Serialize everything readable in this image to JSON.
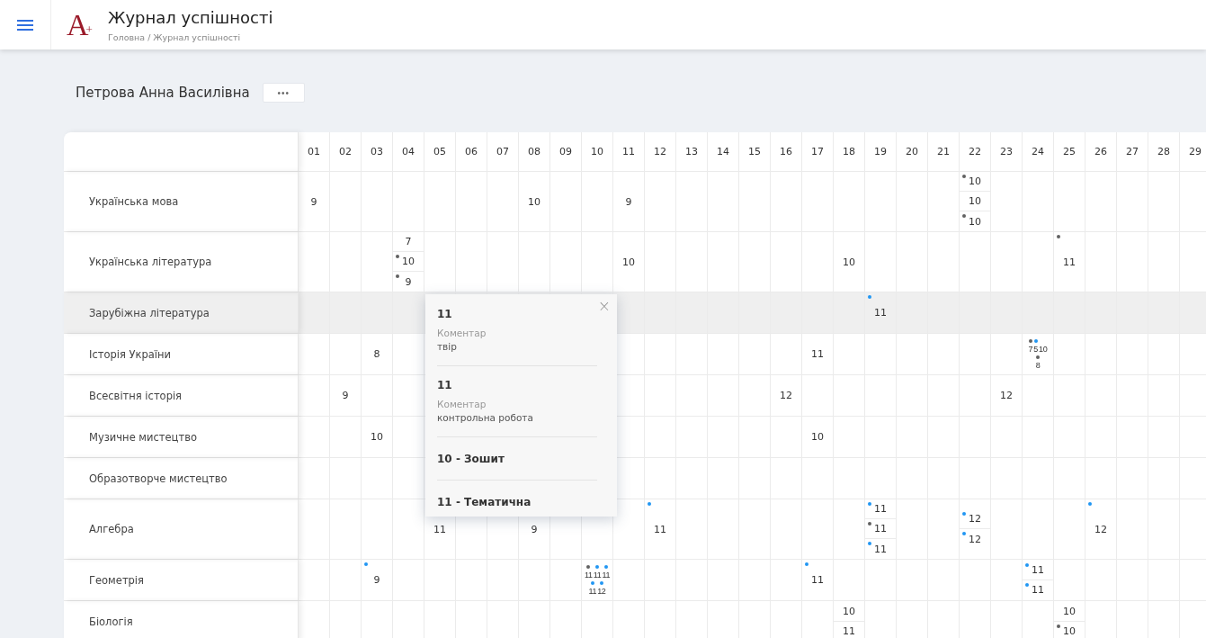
{
  "header": {
    "title": "Журнал успішності",
    "breadcrumb": "Головна / Журнал успішності",
    "logo": "A",
    "logo_sup": "+"
  },
  "student": {
    "name": "Петрова Анна Василівна",
    "more": "•••"
  },
  "days": [
    "01",
    "02",
    "03",
    "04",
    "05",
    "06",
    "07",
    "08",
    "09",
    "10",
    "11",
    "12",
    "13",
    "14",
    "15",
    "16",
    "17",
    "18",
    "19",
    "20",
    "21",
    "22",
    "23",
    "24",
    "25",
    "26",
    "27",
    "28",
    "29"
  ],
  "rows": [
    {
      "subject": "Українська мова",
      "selected": false,
      "cells": {
        "d01": {
          "kind": "stack",
          "marks": [
            {
              "value": "9"
            }
          ]
        },
        "d08": {
          "kind": "stack",
          "marks": [
            {
              "value": "10"
            }
          ]
        },
        "d11": {
          "kind": "stack",
          "marks": [
            {
              "value": "9"
            }
          ]
        },
        "d22": {
          "kind": "stack",
          "marks": [
            {
              "value": "10",
              "color": "#616161"
            },
            {
              "value": "10"
            },
            {
              "value": "10",
              "color": "#616161"
            }
          ]
        }
      }
    },
    {
      "subject": "Українська література",
      "selected": false,
      "cells": {
        "d04": {
          "kind": "stack",
          "marks": [
            {
              "value": "7"
            },
            {
              "value": "10",
              "color": "#616161"
            },
            {
              "value": "9",
              "color": "#616161"
            }
          ]
        },
        "d11": {
          "kind": "stack",
          "marks": [
            {
              "value": "10"
            }
          ]
        },
        "d18": {
          "kind": "stack",
          "marks": [
            {
              "value": "10"
            }
          ]
        },
        "d25": {
          "kind": "stack",
          "marks": [
            {
              "value": "11",
              "color": "#616161"
            }
          ]
        }
      }
    },
    {
      "subject": "Зарубіжна література",
      "selected": true,
      "cells": {
        "d19": {
          "kind": "stack",
          "marks": [
            {
              "value": "11",
              "color": "#2196f3"
            }
          ]
        }
      }
    },
    {
      "subject": "Історія України",
      "selected": false,
      "cells": {
        "d03": {
          "kind": "stack",
          "marks": [
            {
              "value": "8"
            }
          ]
        },
        "d17": {
          "kind": "stack",
          "marks": [
            {
              "value": "11"
            }
          ]
        },
        "d24": {
          "kind": "compact",
          "lines": [
            [
              {
                "value": "7",
                "color": "#616161"
              },
              {
                "value": "5",
                "color": "#2196f3"
              },
              {
                "value": "10"
              }
            ],
            [
              {
                "value": "8",
                "color": "#616161"
              }
            ]
          ]
        }
      }
    },
    {
      "subject": "Всесвітня історія",
      "selected": false,
      "cells": {
        "d02": {
          "kind": "stack",
          "marks": [
            {
              "value": "9"
            }
          ]
        },
        "d16": {
          "kind": "stack",
          "marks": [
            {
              "value": "12"
            }
          ]
        },
        "d23": {
          "kind": "stack",
          "marks": [
            {
              "value": "12"
            }
          ]
        }
      }
    },
    {
      "subject": "Музичне мистецтво",
      "selected": false,
      "cells": {
        "d03": {
          "kind": "stack",
          "marks": [
            {
              "value": "10"
            }
          ]
        },
        "d17": {
          "kind": "stack",
          "marks": [
            {
              "value": "10"
            }
          ]
        }
      }
    },
    {
      "subject": "Образотворче мистецтво",
      "selected": false
    },
    {
      "subject": "Алгебра",
      "selected": false,
      "cells": {
        "d05": {
          "kind": "stack",
          "marks": [
            {
              "value": "11"
            }
          ]
        },
        "d08": {
          "kind": "stack",
          "marks": [
            {
              "value": "9"
            }
          ]
        },
        "d12": {
          "kind": "stack",
          "marks": [
            {
              "value": "11",
              "color": "#2196f3"
            }
          ]
        },
        "d19": {
          "kind": "stack",
          "marks": [
            {
              "value": "11",
              "color": "#2196f3"
            },
            {
              "value": "11",
              "color": "#616161"
            },
            {
              "value": "11",
              "color": "#2196f3"
            }
          ]
        },
        "d22": {
          "kind": "stack",
          "marks": [
            {
              "value": "12",
              "color": "#2196f3"
            },
            {
              "value": "12",
              "color": "#2196f3"
            }
          ]
        },
        "d26": {
          "kind": "stack",
          "marks": [
            {
              "value": "12",
              "color": "#2196f3"
            }
          ]
        }
      }
    },
    {
      "subject": "Геометрія",
      "selected": false,
      "cells": {
        "d03": {
          "kind": "stack",
          "marks": [
            {
              "value": "9",
              "color": "#2196f3"
            }
          ]
        },
        "d10": {
          "kind": "compact",
          "lines": [
            [
              {
                "value": "11",
                "color": "#616161"
              },
              {
                "value": "11",
                "color": "#2196f3"
              },
              {
                "value": "11",
                "color": "#2196f3"
              }
            ],
            [
              {
                "value": "11",
                "color": "#2196f3"
              },
              {
                "value": "12",
                "color": "#2196f3"
              }
            ]
          ]
        },
        "d17": {
          "kind": "stack",
          "marks": [
            {
              "value": "11",
              "color": "#2196f3"
            }
          ]
        },
        "d24": {
          "kind": "stack",
          "marks": [
            {
              "value": "11",
              "color": "#2196f3"
            },
            {
              "value": "11",
              "color": "#2196f3"
            }
          ]
        }
      }
    },
    {
      "subject": "Біологія",
      "selected": false,
      "cells": {
        "d18": {
          "kind": "stack",
          "marks": [
            {
              "value": "10"
            },
            {
              "value": "11"
            }
          ]
        },
        "d25": {
          "kind": "stack",
          "marks": [
            {
              "value": "10"
            },
            {
              "value": "10",
              "color": "#616161"
            }
          ]
        }
      }
    }
  ],
  "popup": {
    "close": "×",
    "entries": [
      {
        "kind": "comment",
        "grade": "11",
        "comment_label": "Коментар",
        "comment": "твір"
      },
      {
        "kind": "comment",
        "grade": "11",
        "comment_label": "Коментар",
        "comment": "контрольна робота"
      },
      {
        "kind": "title",
        "title": "10 - Зошит"
      },
      {
        "kind": "title",
        "title": "11 - Тематична"
      }
    ]
  }
}
